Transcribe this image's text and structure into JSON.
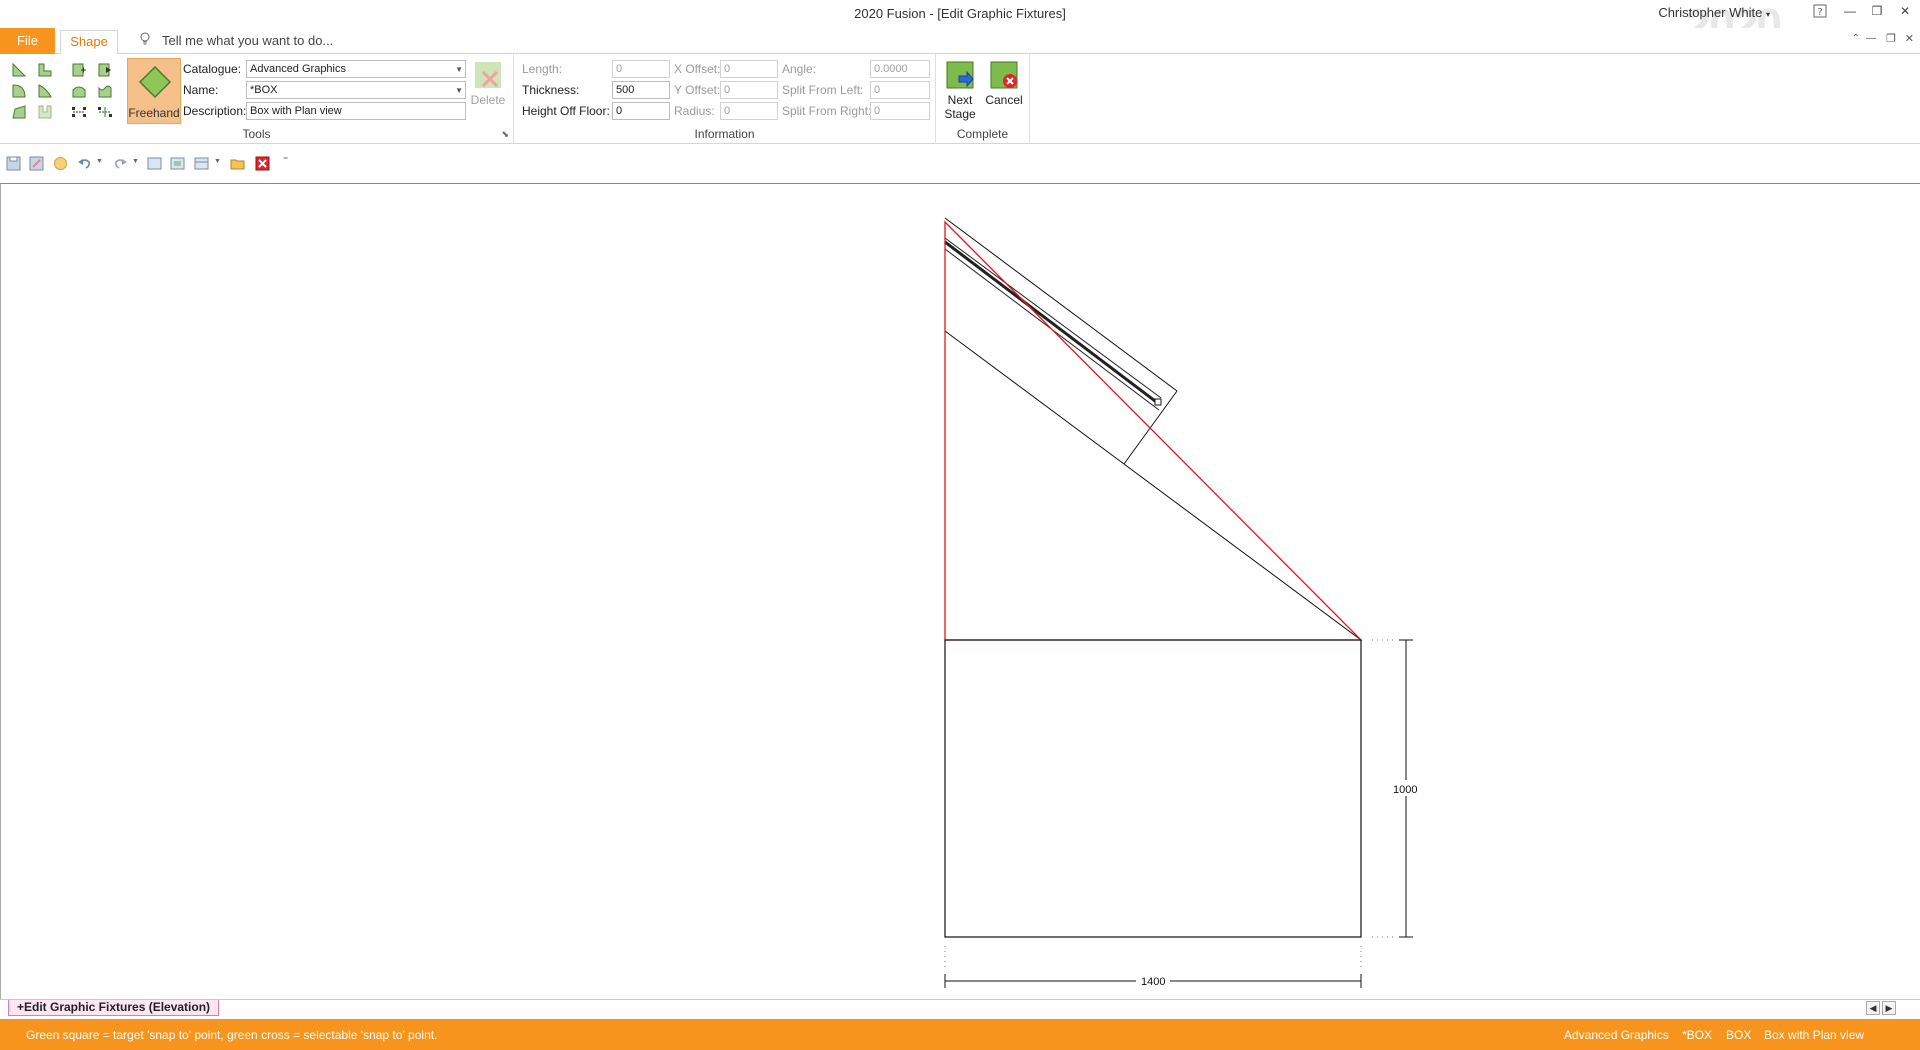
{
  "window": {
    "title": "2020 Fusion - [Edit Graphic Fixtures]",
    "user": "Christopher White",
    "logo": "2020"
  },
  "menu": {
    "file": "File",
    "shape": "Shape",
    "tell_me": "Tell me what you want to do..."
  },
  "tools": {
    "freehand": "Freehand",
    "catalogue_label": "Catalogue:",
    "catalogue_value": "Advanced Graphics",
    "name_label": "Name:",
    "name_value": "*BOX",
    "description_label": "Description:",
    "description_value": "Box with Plan view",
    "delete": "Delete",
    "group_label": "Tools"
  },
  "information": {
    "length_label": "Length:",
    "length_value": "0",
    "thickness_label": "Thickness:",
    "thickness_value": "500",
    "height_label": "Height Off Floor:",
    "height_value": "0",
    "xoffset_label": "X Offset:",
    "xoffset_value": "0",
    "yoffset_label": "Y Offset:",
    "yoffset_value": "0",
    "radius_label": "Radius:",
    "radius_value": "0",
    "angle_label": "Angle:",
    "angle_value": "0.0000",
    "split_left_label": "Split From Left:",
    "split_left_value": "0",
    "split_right_label": "Split From Right:",
    "split_right_value": "0",
    "group_label": "Information"
  },
  "complete": {
    "next_stage_line1": "Next",
    "next_stage_line2": "Stage",
    "cancel": "Cancel",
    "group_label": "Complete"
  },
  "drawing": {
    "dim_height": "1000",
    "dim_width": "1400"
  },
  "sheet_tab": "+Edit Graphic Fixtures (Elevation)",
  "status": {
    "message": "Green square = target 'snap to' point, green cross = selectable 'snap to' point.",
    "catalogue": "Advanced Graphics",
    "name": "*BOX",
    "code": "BOX",
    "description": "Box with Plan view"
  },
  "colors": {
    "accent": "#f7941d",
    "selection": "#e8141c",
    "freehand_bg": "#f5c089"
  }
}
